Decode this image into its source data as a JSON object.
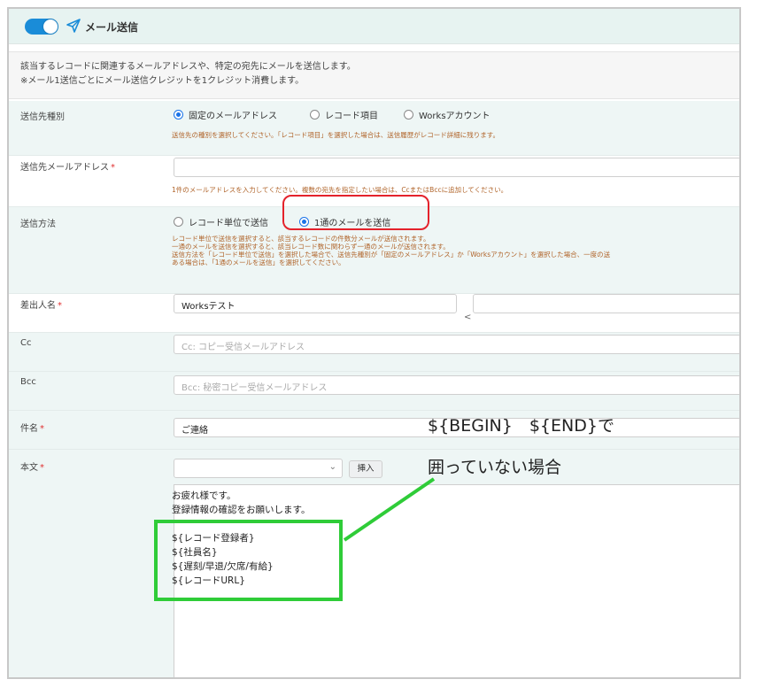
{
  "header": {
    "title": "メール送信",
    "toggle_on": true
  },
  "description": {
    "line1": "該当するレコードに関連するメールアドレスや、特定の宛先にメールを送信します。",
    "line2": "※メール1送信ごとにメール送信クレジットを1クレジット消費します。"
  },
  "recipient_type": {
    "label": "送信先種別",
    "options": [
      "固定のメールアドレス",
      "レコード項目",
      "Worksアカウント"
    ],
    "selected": "固定のメールアドレス",
    "help": "送信先の種別を選択してください。「レコード項目」を選択した場合は、送信履歴がレコード詳細に残ります。"
  },
  "recipient_address": {
    "label": "送信先メールアドレス",
    "value": "",
    "help": "1件のメールアドレスを入力してください。複数の宛先を指定したい場合は、CcまたはBccに追加してください。"
  },
  "send_method": {
    "label": "送信方法",
    "options": [
      "レコード単位で送信",
      "1通のメールを送信"
    ],
    "selected": "1通のメールを送信",
    "help1": "レコード単位で送信を選択すると、該当するレコードの件数分メールが送信されます。",
    "help2": "一通のメールを送信を選択すると、該当レコード数に関わらず一通のメールが送信されます。",
    "help3": "送信方法を「レコード単位で送信」を選択した場合で、送信先種別が「固定のメールアドレス」か「Worksアカウント」を選択した場合、一度の送",
    "help4": "ある場合は、「1通のメールを送信」を選択してください。"
  },
  "sender_name": {
    "label": "差出人名",
    "value": "Worksテスト",
    "lt": "<",
    "address_value": ""
  },
  "cc": {
    "label": "Cc",
    "placeholder": "Cc: コピー受信メールアドレス"
  },
  "bcc": {
    "label": "Bcc",
    "placeholder": "Bcc: 秘密コピー受信メールアドレス"
  },
  "subject": {
    "label": "件名",
    "value": "ご連絡"
  },
  "body": {
    "label": "本文",
    "insert_label": "挿入",
    "lines": [
      "お疲れ様です。",
      "登録情報の確認をお願いします。",
      "",
      "${レコード登録者}",
      "${社員名}",
      "${遅刻/早退/欠席/有給}",
      "${レコードURL}"
    ]
  },
  "required_mark": "*",
  "annotation": {
    "line1": "${BEGIN}　${END}で",
    "line2": "囲っていない場合"
  },
  "colors": {
    "accent": "#1a8cd8",
    "header_bg": "#e7f3f1",
    "help_text": "#b0642a",
    "required": "#e03030",
    "highlight_red": "#e4222b",
    "highlight_green": "#2fcc38"
  }
}
